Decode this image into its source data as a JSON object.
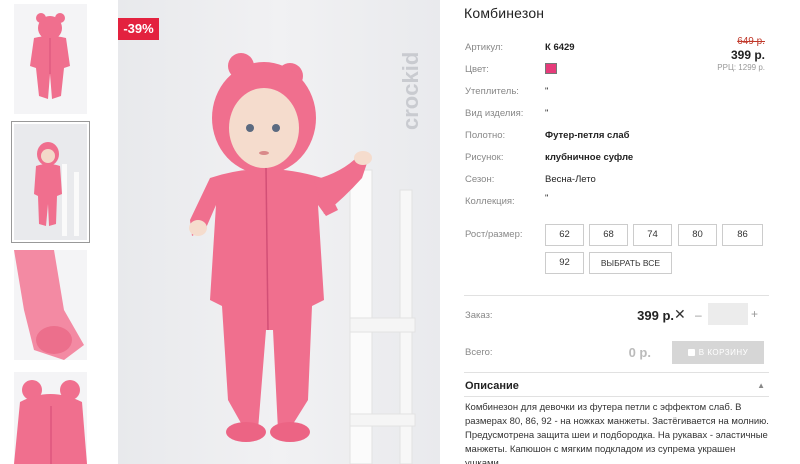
{
  "product": {
    "title": "Комбинезон",
    "discount_badge": "-39%",
    "brand_watermark": "crockid",
    "old_price": "649 р.",
    "price": "399 р.",
    "rrp": "РРЦ: 1299 р.",
    "color_hex": "#e63b7a"
  },
  "specs": [
    {
      "label": "Артикул:",
      "value": "К 6429",
      "bold": true
    },
    {
      "label": "Цвет:",
      "value": ""
    },
    {
      "label": "Утеплитель:",
      "value": "\""
    },
    {
      "label": "Вид изделия:",
      "value": "\""
    },
    {
      "label": "Полотно:",
      "value": "Футер-петля слаб",
      "bold": true
    },
    {
      "label": "Рисунок:",
      "value": "клубничное суфле",
      "bold": true
    },
    {
      "label": "Сезон:",
      "value": "Весна-Лето"
    },
    {
      "label": "Коллекция:",
      "value": "\""
    }
  ],
  "sizes": {
    "label": "Рост/размер:",
    "options": [
      "62",
      "68",
      "74",
      "80",
      "86",
      "92"
    ],
    "select_all": "ВЫБРАТЬ ВСЕ"
  },
  "order": {
    "label": "Заказ:",
    "unit_price": "399 р.",
    "multiply": "✕",
    "minus": "–",
    "plus": "+",
    "qty_value": "",
    "total_label": "Всего:",
    "total_price": "0 р.",
    "cart_button": "В КОРЗИНУ"
  },
  "description": {
    "heading": "Описание",
    "caret": "▲",
    "text": "Комбинезон для девочки из футера петли с эффектом слаб. В размерах 80, 86, 92 - на ножках манжеты. Застёгивается на молнию. Предусмотрена защита шеи и подбородка. На рукавах - эластичные манжеты. Капюшон с мягким подкладом из супрема украшен ушками."
  },
  "colors": {
    "accent": "#e3223f",
    "garment_pink": "#f06f8e"
  }
}
